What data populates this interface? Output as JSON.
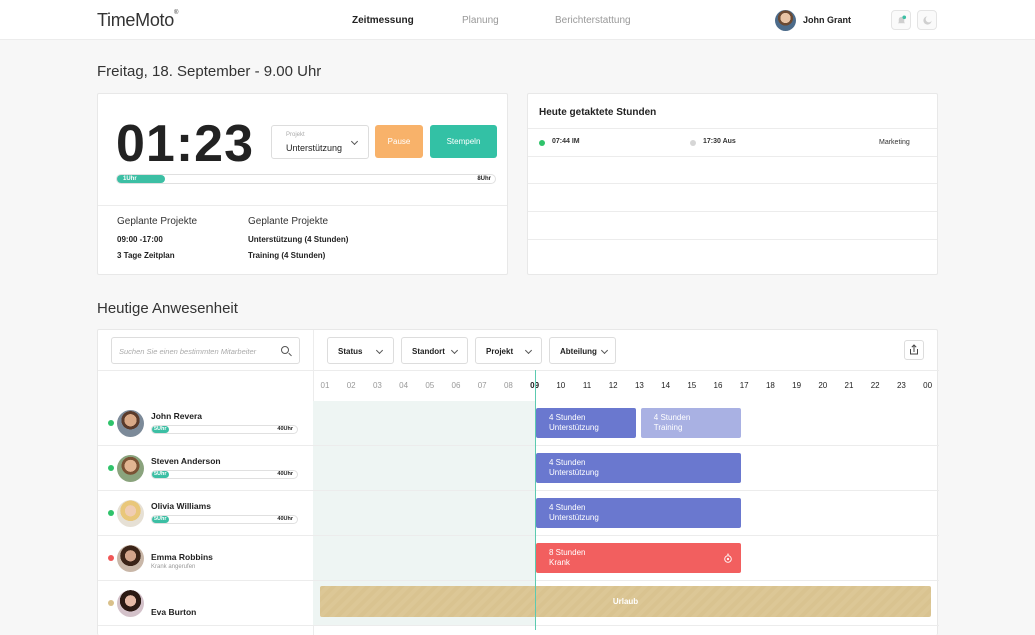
{
  "header": {
    "logo": "TimeMoto",
    "logo_mark": "®",
    "nav": [
      "Zeitmessung",
      "Planung",
      "Berichterstattung"
    ],
    "user_name": "John Grant"
  },
  "date_title": "Freitag, 18. September - 9.00 Uhr",
  "timer": {
    "value": "01:23",
    "project_label": "Projekt",
    "project_value": "Unterstützung",
    "pause_label": "Pause",
    "clock_in_label": "Stempeln",
    "progress_start": "1Uhr",
    "progress_end": "8Uhr",
    "progress_fraction": 0.125,
    "planned_left_title": "Geplante Projekte",
    "planned_left_lines": [
      "09:00 -17:00",
      "3 Tage Zeitplan"
    ],
    "planned_right_title": "Geplante Projekte",
    "planned_right_lines": [
      "Unterstützung (4 Stunden)",
      "Training (4 Stunden)"
    ]
  },
  "clocked": {
    "title": "Heute getaktete Stunden",
    "row": {
      "in": "07:44 IM",
      "out": "17:30 Aus",
      "department": "Marketing"
    }
  },
  "attendance": {
    "title": "Heutige Anwesenheit",
    "search_placeholder": "Suchen Sie einen bestimmten Mitarbeiter",
    "filters": [
      "Status",
      "Standort",
      "Projekt",
      "Abteilung"
    ],
    "hours": [
      "01",
      "02",
      "03",
      "04",
      "05",
      "06",
      "07",
      "08",
      "09",
      "10",
      "11",
      "12",
      "13",
      "14",
      "15",
      "16",
      "17",
      "18",
      "19",
      "20",
      "21",
      "22",
      "23",
      "00"
    ],
    "employees": [
      {
        "name": "John Revera",
        "progress_start": "5Uhr",
        "progress_end": "40Uhr",
        "status_color": "#2fc36b",
        "shifts": [
          {
            "line1": "4 Stunden",
            "line2": "Unterstützung",
            "start": 9,
            "end": 13,
            "color": "#6a78cf"
          },
          {
            "line1": "4 Stunden",
            "line2": "Training",
            "start": 13,
            "end": 17,
            "color": "#a9b1e3"
          }
        ]
      },
      {
        "name": "Steven Anderson",
        "progress_start": "5Uhr",
        "progress_end": "40Uhr",
        "status_color": "#2fc36b",
        "shifts": [
          {
            "line1": "4 Stunden",
            "line2": "Unterstützung",
            "start": 9,
            "end": 17,
            "color": "#6a78cf"
          }
        ]
      },
      {
        "name": "Olivia Williams",
        "progress_start": "5Uhr",
        "progress_end": "40Uhr",
        "status_color": "#2fc36b",
        "shifts": [
          {
            "line1": "4 Stunden",
            "line2": "Unterstützung",
            "start": 9,
            "end": 17,
            "color": "#6a78cf"
          }
        ]
      },
      {
        "name": "Emma Robbins",
        "subtitle": "Krank angerufen",
        "status_color": "#f05656",
        "shifts": [
          {
            "line1": "8 Stunden",
            "line2": "Krank",
            "start": 9,
            "end": 17,
            "color": "#f25f5f"
          }
        ]
      },
      {
        "name": "Eva Burton",
        "status_color": "#d9c08a",
        "vacation_label": "Urlaub"
      }
    ]
  },
  "colors": {
    "accent": "#3cbfa4",
    "pause": "#f8b26a",
    "clock_in": "#33c1a5"
  }
}
